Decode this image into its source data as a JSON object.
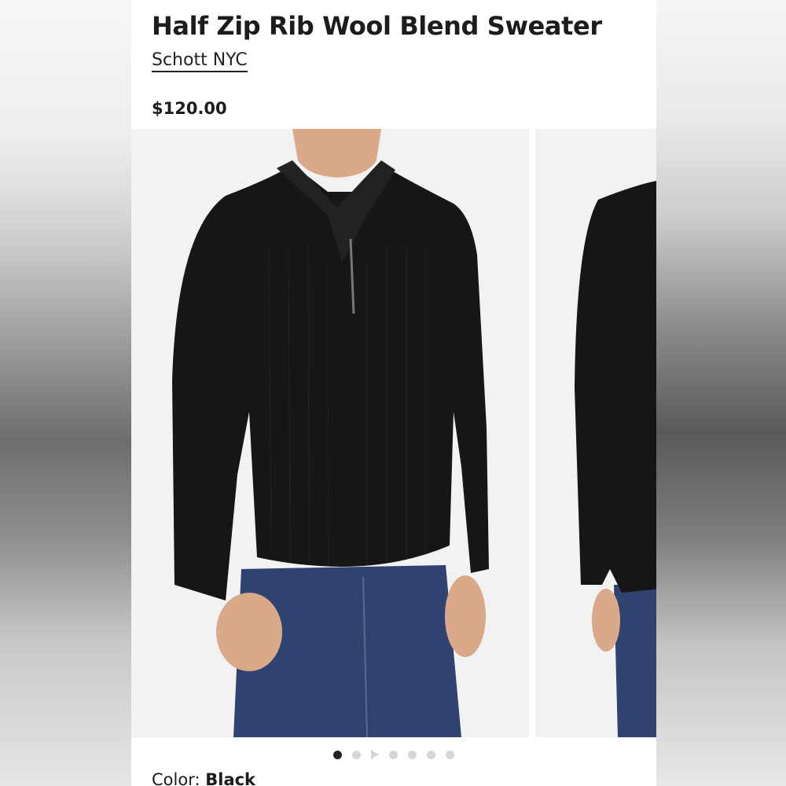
{
  "product": {
    "title": "Half Zip Rib Wool Blend Sweater",
    "brand": "Schott NYC",
    "price": "$120.00",
    "color_label": "Color:",
    "color_value": "Black"
  },
  "gallery": {
    "images": [
      {
        "description_icon": "product-photo-front"
      },
      {
        "description_icon": "product-photo-side"
      }
    ],
    "dots": [
      "active",
      "inactive",
      "video",
      "inactive",
      "inactive",
      "inactive",
      "inactive"
    ]
  },
  "colors": {
    "sweater": "#161616",
    "denim": "#2f4270",
    "skin": "#d9a98a",
    "background": "#f2f2f2"
  }
}
